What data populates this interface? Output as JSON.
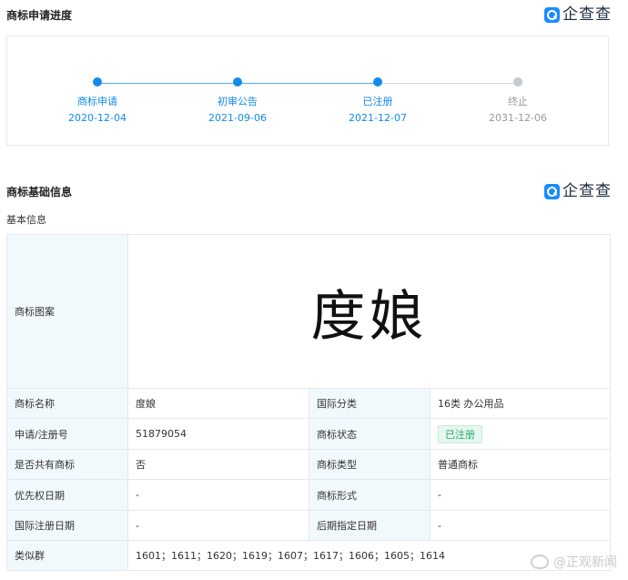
{
  "progress_section": {
    "title": "商标申请进度",
    "brand": "企查查",
    "steps": [
      {
        "label": "商标申请",
        "date": "2020-12-04",
        "status": "done"
      },
      {
        "label": "初审公告",
        "date": "2021-09-06",
        "status": "done"
      },
      {
        "label": "已注册",
        "date": "2021-12-07",
        "status": "done"
      },
      {
        "label": "终止",
        "date": "2031-12-06",
        "status": "future"
      }
    ]
  },
  "info_section": {
    "title": "商标基础信息",
    "brand": "企查查",
    "subtitle": "基本信息",
    "logo_label": "商标图案",
    "logo_text": "度娘",
    "rows": {
      "name_label": "商标名称",
      "name_value": "度娘",
      "intl_class_label": "国际分类",
      "intl_class_value": "16类 办公用品",
      "reg_no_label": "申请/注册号",
      "reg_no_value": "51879054",
      "status_label": "商标状态",
      "status_value": "已注册",
      "shared_label": "是否共有商标",
      "shared_value": "否",
      "type_label": "商标类型",
      "type_value": "普通商标",
      "priority_date_label": "优先权日期",
      "priority_date_value": "-",
      "form_label": "商标形式",
      "form_value": "-",
      "intl_reg_date_label": "国际注册日期",
      "intl_reg_date_value": "-",
      "later_date_label": "后期指定日期",
      "later_date_value": "-",
      "similar_group_label": "类似群",
      "similar_group_value": "1601；1611；1620；1619；1607；1617；1606；1605；1614"
    }
  },
  "watermark": "@正观新闻",
  "colors": {
    "accent": "#128bed",
    "future": "#c6c9ce",
    "label_bg": "#f2f9fc",
    "badge_green": "#2aa96b"
  }
}
